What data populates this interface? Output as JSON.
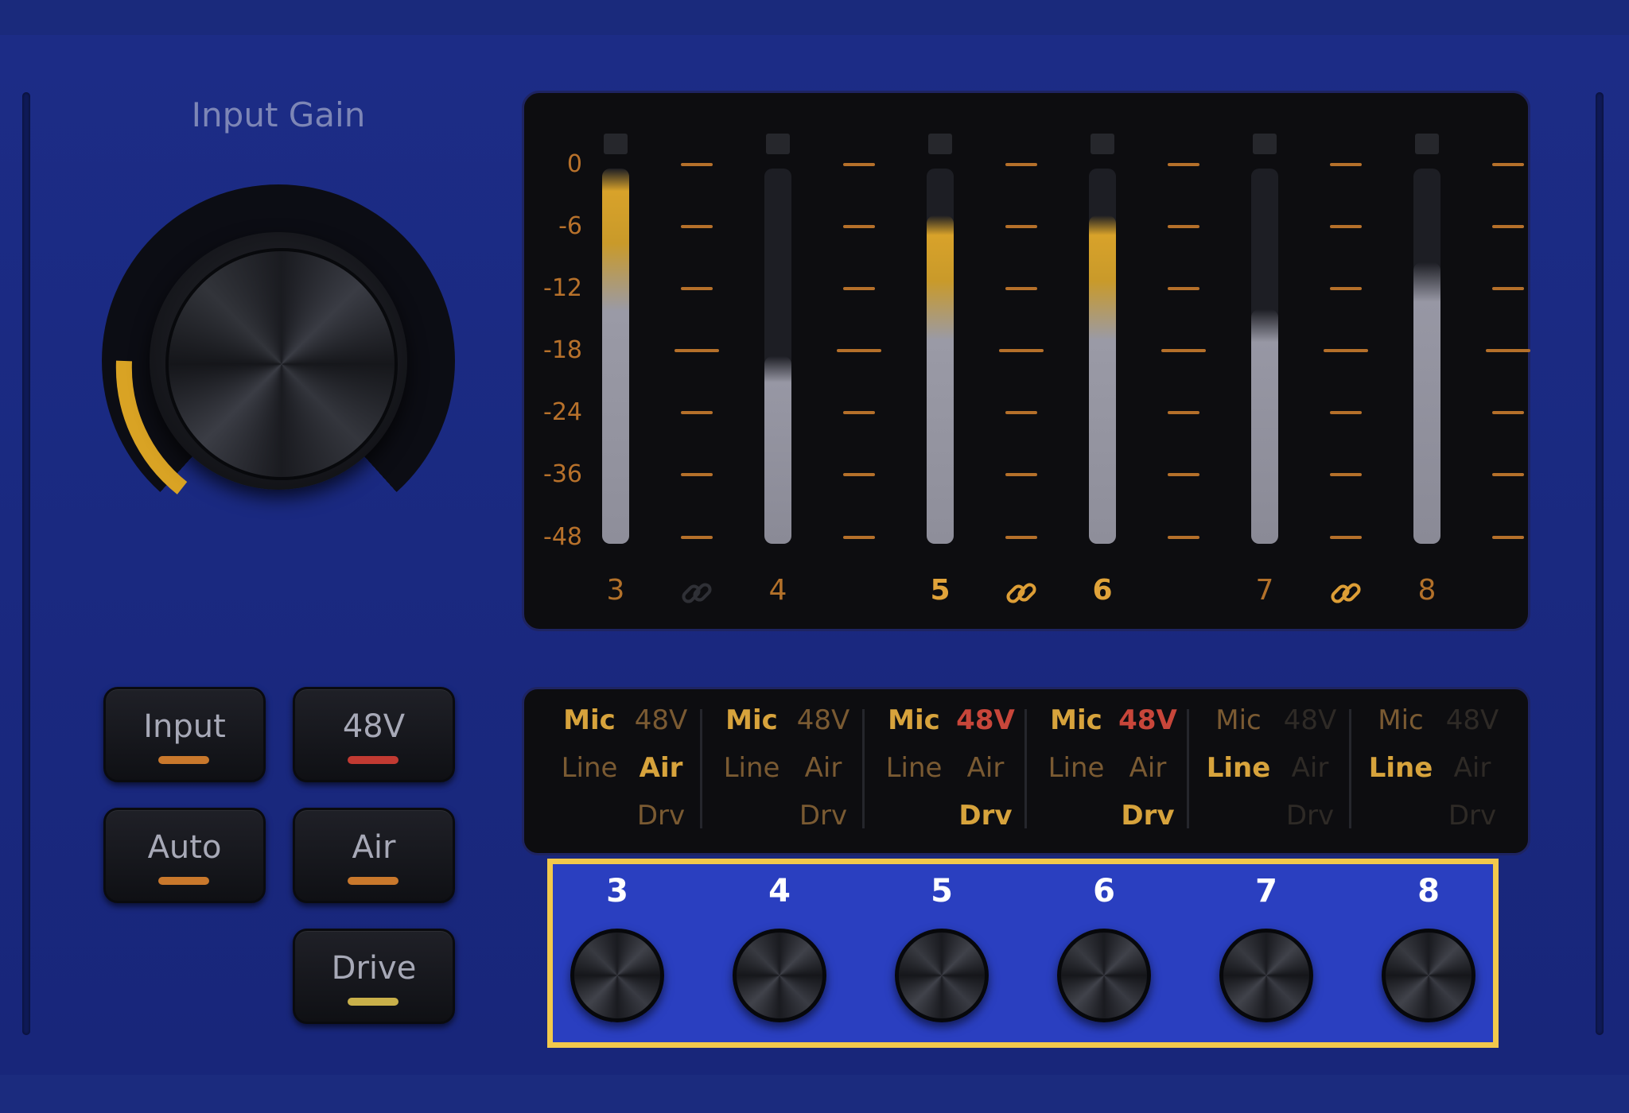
{
  "input_gain": {
    "title": "Input Gain",
    "arc_color": "#d9a324"
  },
  "controls": [
    {
      "label": "Input",
      "led_color": "#c9782c"
    },
    {
      "label": "48V",
      "led_color": "#c23a32"
    },
    {
      "label": "Auto",
      "led_color": "#c9782c"
    },
    {
      "label": "Air",
      "led_color": "#c9782c"
    },
    {
      "label": "Drive",
      "led_color": "#c9b04a"
    }
  ],
  "meter": {
    "scale": [
      "0",
      "-6",
      "-12",
      "-18",
      "-24",
      "-36",
      "-48"
    ],
    "channels": [
      {
        "number": "3",
        "level_db": 0,
        "active": false
      },
      {
        "number": "4",
        "level_db": -24,
        "active": false
      },
      {
        "number": "5",
        "level_db": -6,
        "active": true
      },
      {
        "number": "6",
        "level_db": -6,
        "active": true
      },
      {
        "number": "7",
        "level_db": -18,
        "active": false
      },
      {
        "number": "8",
        "level_db": -12,
        "active": false
      }
    ],
    "links": [
      {
        "pair": "3-4",
        "linked": false
      },
      {
        "pair": "5-6",
        "linked": true
      },
      {
        "pair": "7-8",
        "linked": true
      }
    ]
  },
  "modes": [
    {
      "channel": "3",
      "mic": "Mic",
      "line": "Line",
      "v48": "48V",
      "air": "Air",
      "drv": "Drv"
    },
    {
      "channel": "4",
      "mic": "Mic",
      "line": "Line",
      "v48": "48V",
      "air": "Air",
      "drv": "Drv"
    },
    {
      "channel": "5",
      "mic": "Mic",
      "line": "Line",
      "v48": "48V",
      "air": "Air",
      "drv": "Drv"
    },
    {
      "channel": "6",
      "mic": "Mic",
      "line": "Line",
      "v48": "48V",
      "air": "Air",
      "drv": "Drv"
    },
    {
      "channel": "7",
      "mic": "Mic",
      "line": "Line",
      "v48": "48V",
      "air": "Air",
      "drv": "Drv"
    },
    {
      "channel": "8",
      "mic": "Mic",
      "line": "Line",
      "v48": "48V",
      "air": "Air",
      "drv": "Drv"
    }
  ],
  "channel_knobs": [
    "3",
    "4",
    "5",
    "6",
    "7",
    "8"
  ]
}
